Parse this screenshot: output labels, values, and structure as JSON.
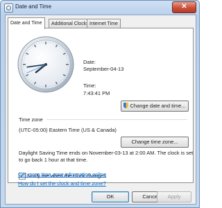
{
  "window": {
    "title": "Date and Time",
    "close_glyph": "✕"
  },
  "tabs": [
    {
      "label": "Date and Time",
      "active": true
    },
    {
      "label": "Additional Clocks",
      "active": false
    },
    {
      "label": "Internet Time",
      "active": false
    }
  ],
  "datetime": {
    "date_label": "Date:",
    "date_value": "September-04-13",
    "time_label": "Time:",
    "time_value": "7:43:41 PM",
    "change_button": "Change date and time..."
  },
  "clock": {
    "hour": 7,
    "minute": 43,
    "second": 41
  },
  "timezone": {
    "section_label": "Time zone",
    "value": "(UTC-05:00) Eastern Time (US & Canada)",
    "change_button": "Change time zone..."
  },
  "dst": {
    "line1": "Daylight Saving Time ends on November-03-13 at 2:00 AM. The clock is set",
    "line2": "to go back 1 hour at that time."
  },
  "notify": {
    "label": "Notify me when the clock changes",
    "checked": true
  },
  "links": {
    "more_info": "Get more time zone information online",
    "how_to": "How do I set the clock and time zone?"
  },
  "footer": {
    "ok": "OK",
    "cancel": "Cancel",
    "apply": "Apply"
  }
}
